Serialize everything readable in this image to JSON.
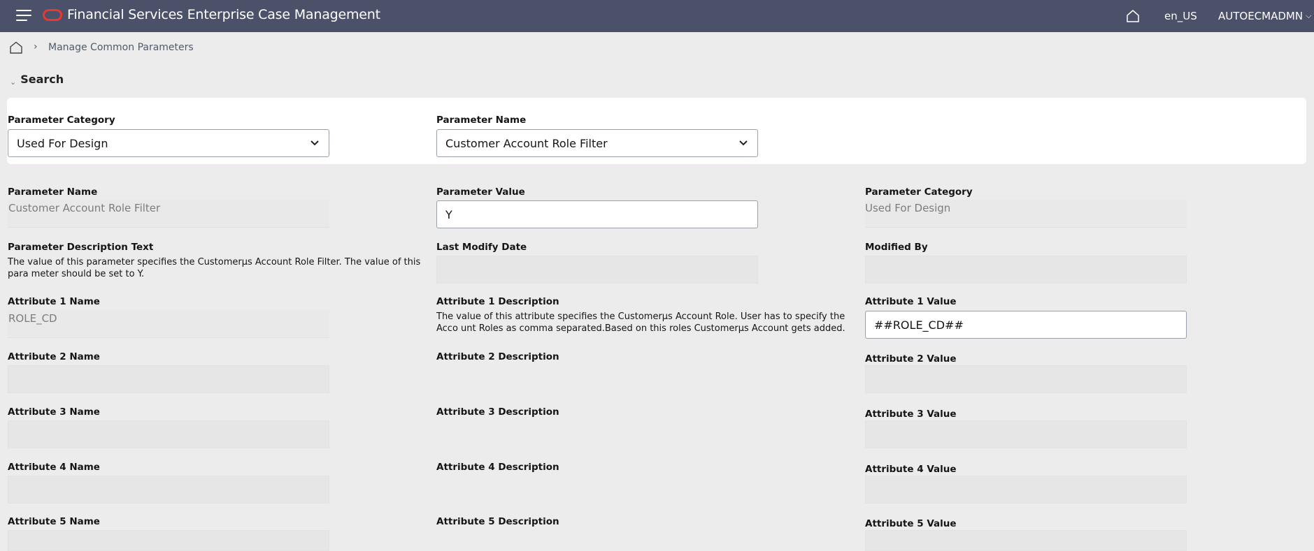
{
  "header": {
    "title": "Financial Services Enterprise Case Management",
    "locale": "en_US",
    "user": "AUTOECMADMN"
  },
  "breadcrumb": {
    "current": "Manage Common Parameters"
  },
  "search": {
    "toggle_label": "Search",
    "category_label": "Parameter Category",
    "category_value": "Used For Design",
    "name_label": "Parameter Name",
    "name_value": "Customer Account Role Filter"
  },
  "details": {
    "param_name_label": "Parameter Name",
    "param_name_value": "Customer Account Role Filter",
    "param_value_label": "Parameter Value",
    "param_value_value": "Y",
    "param_category_label": "Parameter Category",
    "param_category_value": "Used For Design",
    "desc_text_label": "Parameter Description Text",
    "desc_text_value": "The value of this parameter specifies the Customerµs Account Role Filter. The value of this para meter should be set to Y.",
    "last_modify_label": "Last Modify Date",
    "modified_by_label": "Modified By",
    "attributes": [
      {
        "name_label": "Attribute 1 Name",
        "name_value": "ROLE_CD",
        "desc_label": "Attribute 1 Description",
        "desc_value": "The value of this attribute specifies the Customerµs Account Role. User has to specify the Acco unt Roles as comma separated.Based on this roles Customerµs Account gets added.",
        "value_label": "Attribute 1 Value",
        "value_value": "##ROLE_CD##"
      },
      {
        "name_label": "Attribute 2 Name",
        "name_value": "",
        "desc_label": "Attribute 2 Description",
        "desc_value": "",
        "value_label": "Attribute 2 Value",
        "value_value": ""
      },
      {
        "name_label": "Attribute 3 Name",
        "name_value": "",
        "desc_label": "Attribute 3 Description",
        "desc_value": "",
        "value_label": "Attribute 3 Value",
        "value_value": ""
      },
      {
        "name_label": "Attribute 4 Name",
        "name_value": "",
        "desc_label": "Attribute 4 Description",
        "desc_value": "",
        "value_label": "Attribute 4 Value",
        "value_value": ""
      },
      {
        "name_label": "Attribute 5 Name",
        "name_value": "",
        "desc_label": "Attribute 5 Description",
        "desc_value": "",
        "value_label": "Attribute 5 Value",
        "value_value": ""
      }
    ]
  },
  "colors": {
    "header_bg": "#4c516a",
    "oracle_red": "#e8392c",
    "page_bg": "#ececec"
  },
  "icons": [
    "menu-icon",
    "oracle-logo",
    "home-icon",
    "chevron-down-icon",
    "chevron-right-icon"
  ]
}
